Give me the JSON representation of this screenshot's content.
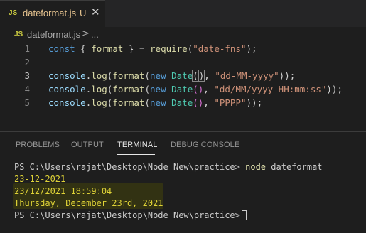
{
  "tab": {
    "icon": "js-file-icon",
    "icon_text": "JS",
    "filename": "dateformat.js",
    "badge": "U",
    "close_icon": "close-icon"
  },
  "breadcrumb": {
    "icon_text": "JS",
    "file": "dateformat.js",
    "separator": ">",
    "more": "..."
  },
  "editor": {
    "line_numbers": [
      "1",
      "2",
      "3",
      "4",
      "5"
    ],
    "active_line": "3",
    "lines": [
      "const { format } = require(\"date-fns\");",
      "",
      "console.log(format(new Date(), \"dd-MM-yyyy\"));",
      "console.log(format(new Date(), \"dd/MM/yyyy HH:mm:ss\"));",
      "console.log(format(new Date(), \"PPPP\"));"
    ]
  },
  "panel": {
    "tabs": [
      "PROBLEMS",
      "OUTPUT",
      "TERMINAL",
      "DEBUG CONSOLE"
    ],
    "active_tab": "TERMINAL"
  },
  "terminal": {
    "prompt": "PS C:\\Users\\rajat\\Desktop\\Node New\\practice>",
    "command": "node",
    "args": "dateformat",
    "output": [
      "23-12-2021",
      "23/12/2021 18:59:04",
      "Thursday, December 23rd, 2021"
    ]
  },
  "colors": {
    "editor_bg": "#1e1e1e",
    "tab_bar_bg": "#252526",
    "untracked_file": "#e2c08d",
    "terminal_output": "#dfd337"
  }
}
